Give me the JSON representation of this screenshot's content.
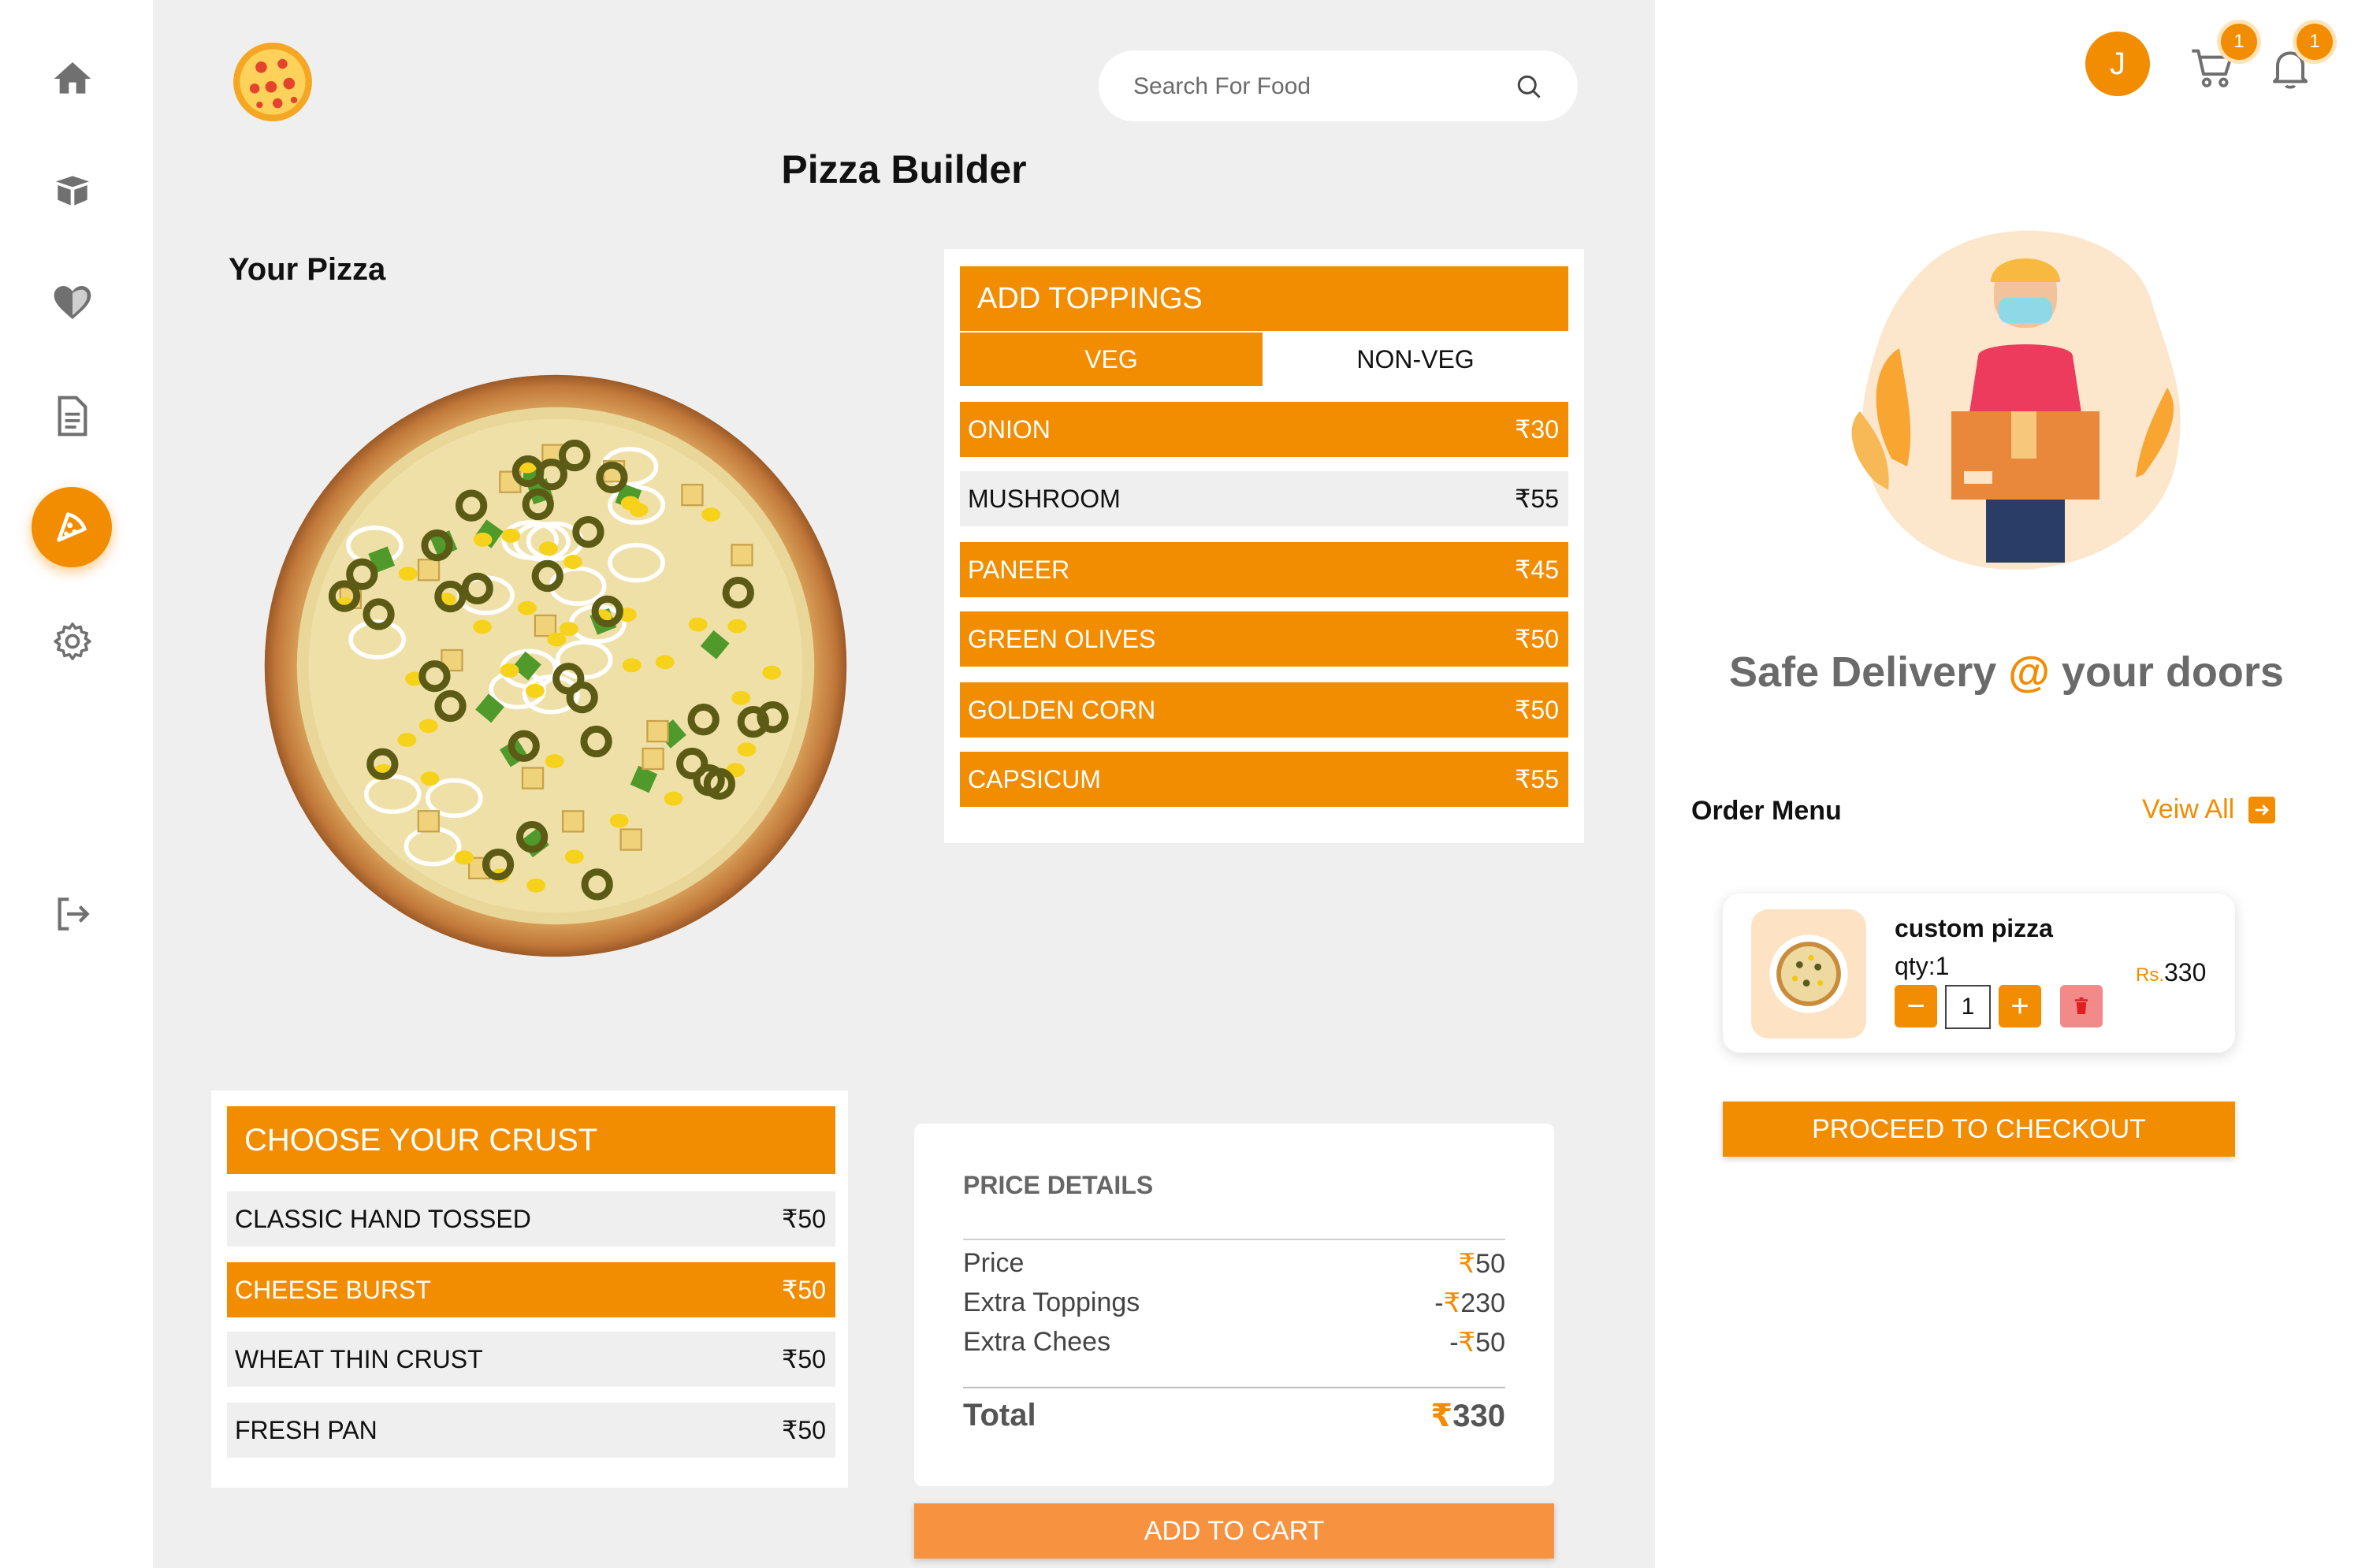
{
  "sidebar": {
    "items": [
      {
        "icon": "home-icon"
      },
      {
        "icon": "box-icon"
      },
      {
        "icon": "heart-icon"
      },
      {
        "icon": "document-icon"
      },
      {
        "icon": "pizza-icon",
        "active": true
      },
      {
        "icon": "gear-icon"
      },
      {
        "icon": "logout-icon"
      }
    ]
  },
  "header": {
    "logo": "pizza-logo",
    "search": {
      "placeholder": "Search For Food"
    },
    "title": "Pizza Builder"
  },
  "your_pizza": {
    "label": "Your Pizza"
  },
  "toppings": {
    "title": "ADD TOPPINGS",
    "tabs": [
      {
        "label": "VEG",
        "active": true
      },
      {
        "label": "NON-VEG",
        "active": false
      }
    ],
    "items": [
      {
        "name": "ONION",
        "price": "₹30",
        "selected": true
      },
      {
        "name": "MUSHROOM",
        "price": "₹55",
        "selected": false
      },
      {
        "name": "PANEER",
        "price": "₹45",
        "selected": true
      },
      {
        "name": "GREEN OLIVES",
        "price": "₹50",
        "selected": true
      },
      {
        "name": "GOLDEN CORN",
        "price": "₹50",
        "selected": true
      },
      {
        "name": "CAPSICUM",
        "price": "₹55",
        "selected": true
      }
    ]
  },
  "crust": {
    "title": "CHOOSE YOUR CRUST",
    "items": [
      {
        "name": "CLASSIC HAND TOSSED",
        "price": "₹50",
        "selected": false
      },
      {
        "name": "CHEESE BURST",
        "price": "₹50",
        "selected": true
      },
      {
        "name": "WHEAT THIN CRUST",
        "price": "₹50",
        "selected": false
      },
      {
        "name": "FRESH PAN",
        "price": "₹50",
        "selected": false
      }
    ]
  },
  "price_details": {
    "title": "PRICE DETAILS",
    "rows": [
      {
        "label": "Price",
        "prefix": "",
        "symbol": "₹",
        "amount": "50"
      },
      {
        "label": "Extra Toppings",
        "prefix": "-",
        "symbol": "₹",
        "amount": "230"
      },
      {
        "label": "Extra Chees",
        "prefix": "-",
        "symbol": "₹",
        "amount": "50"
      }
    ],
    "total_label": "Total",
    "total_symbol": "₹",
    "total_amount": "330"
  },
  "add_to_cart": "ADD TO CART",
  "account": {
    "avatar_initial": "J",
    "cart_count": "1",
    "notification_count": "1"
  },
  "promo": {
    "tagline_start": "Safe Delivery ",
    "tagline_at": "@",
    "tagline_end": " your doors"
  },
  "order_menu": {
    "title": "Order Menu",
    "view_all": "Veiw All",
    "items": [
      {
        "name": "custom pizza",
        "qty_text": "qty:1",
        "qty_value": "1",
        "currency": "Rs.",
        "price": "330"
      }
    ],
    "checkout": "PROCEED TO CHECKOUT"
  },
  "colors": {
    "accent": "#f28c00",
    "background": "#efefef"
  }
}
